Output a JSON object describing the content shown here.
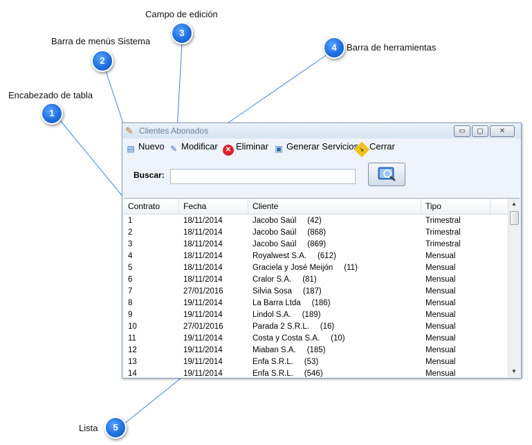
{
  "callouts": [
    {
      "number": "1",
      "label": "Encabezado de tabla"
    },
    {
      "number": "2",
      "label": "Barra de menús Sistema"
    },
    {
      "number": "3",
      "label": "Campo de edición"
    },
    {
      "number": "4",
      "label": "Barra de herramientas"
    },
    {
      "number": "5",
      "label": "Lista"
    }
  ],
  "window": {
    "title": "Clientes Abonados",
    "minimize_glyph": "▭",
    "maximize_glyph": "▢",
    "close_glyph": "✕"
  },
  "toolbar": {
    "new_label": "Nuevo",
    "edit_label": "Modificar",
    "delete_label": "Eliminar",
    "generate_label": "Generar Servicios",
    "close_label": "Cerrar"
  },
  "search": {
    "label": "Buscar:",
    "value": ""
  },
  "table": {
    "columns": [
      "Contrato",
      "Fecha",
      "Cliente",
      "Tipo"
    ],
    "rows": [
      [
        "1",
        "18/11/2014",
        "Jacobo Saúl     (42)",
        "Trimestral"
      ],
      [
        "2",
        "18/11/2014",
        "Jacobo Saúl     (868)",
        "Trimestral"
      ],
      [
        "3",
        "18/11/2014",
        "Jacobo Saúl     (869)",
        "Trimestral"
      ],
      [
        "4",
        "18/11/2014",
        "Royalwest S.A.     (612)",
        "Mensual"
      ],
      [
        "5",
        "18/11/2014",
        "Graciela y José Meijón     (11)",
        "Mensual"
      ],
      [
        "6",
        "18/11/2014",
        "Cralor S.A.     (81)",
        "Mensual"
      ],
      [
        "7",
        "27/01/2016",
        "Silvia Sosa     (187)",
        "Mensual"
      ],
      [
        "8",
        "19/11/2014",
        "La Barra Ltda     (186)",
        "Mensual"
      ],
      [
        "9",
        "19/11/2014",
        "Lindol S.A.     (189)",
        "Mensual"
      ],
      [
        "10",
        "27/01/2016",
        "Parada 2 S.R.L.     (16)",
        "Mensual"
      ],
      [
        "11",
        "19/11/2014",
        "Costa y Costa S.A.     (10)",
        "Mensual"
      ],
      [
        "12",
        "19/11/2014",
        "Miaban S.A.     (185)",
        "Mensual"
      ],
      [
        "13",
        "19/11/2014",
        "Enfa S.R.L.     (53)",
        "Mensual"
      ],
      [
        "14",
        "19/11/2014",
        "Enfa S.R.L.     (546)",
        "Mensual"
      ]
    ]
  },
  "colors": {
    "badge": "#1f6fe0",
    "callout_line": "#3b82d6"
  }
}
